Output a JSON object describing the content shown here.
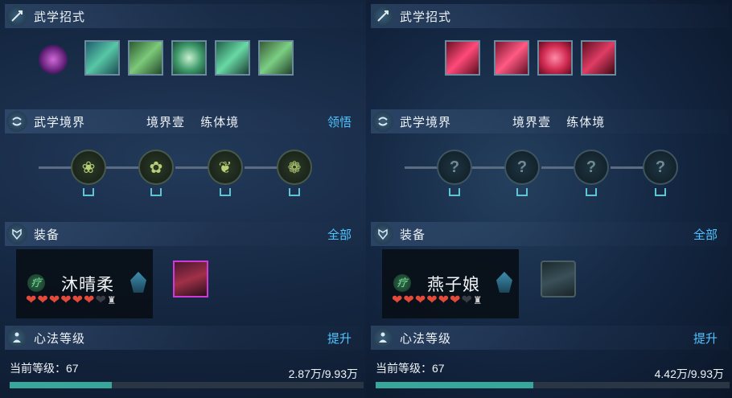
{
  "panels": [
    {
      "skills_header": {
        "title": "武学招式"
      },
      "realm_header": {
        "title": "武学境界",
        "realm": "境界壹",
        "stage": "练体境",
        "action": "领悟"
      },
      "equip_header": {
        "title": "装备",
        "action": "全部"
      },
      "card": {
        "name": "沐晴柔",
        "role_icon": "疗"
      },
      "heal_hearts": {
        "filled": 6,
        "total": 7
      },
      "xinfa_header": {
        "title": "心法等级",
        "action": "提升"
      },
      "level_text": "当前等级：67",
      "exp_text": "2.87万/9.93万",
      "exp_progress": 0.289,
      "skill_color": "#3bbf8a"
    },
    {
      "skills_header": {
        "title": "武学招式"
      },
      "realm_header": {
        "title": "武学境界",
        "realm": "境界壹",
        "stage": "练体境",
        "action": ""
      },
      "equip_header": {
        "title": "装备",
        "action": "全部"
      },
      "card": {
        "name": "燕子娘",
        "role_icon": "疗"
      },
      "heal_hearts": {
        "filled": 6,
        "total": 7
      },
      "xinfa_header": {
        "title": "心法等级",
        "action": "提升"
      },
      "level_text": "当前等级：67",
      "exp_text": "4.42万/9.93万",
      "exp_progress": 0.445,
      "skill_color": "#e0345c"
    }
  ],
  "icons": {
    "skills_header": "sword-icon",
    "realm_header": "swirl-icon",
    "equip_header": "armor-icon",
    "xinfa_header": "meditation-icon",
    "node_unlocked": "lotus-icon",
    "node_locked": "question-icon"
  }
}
